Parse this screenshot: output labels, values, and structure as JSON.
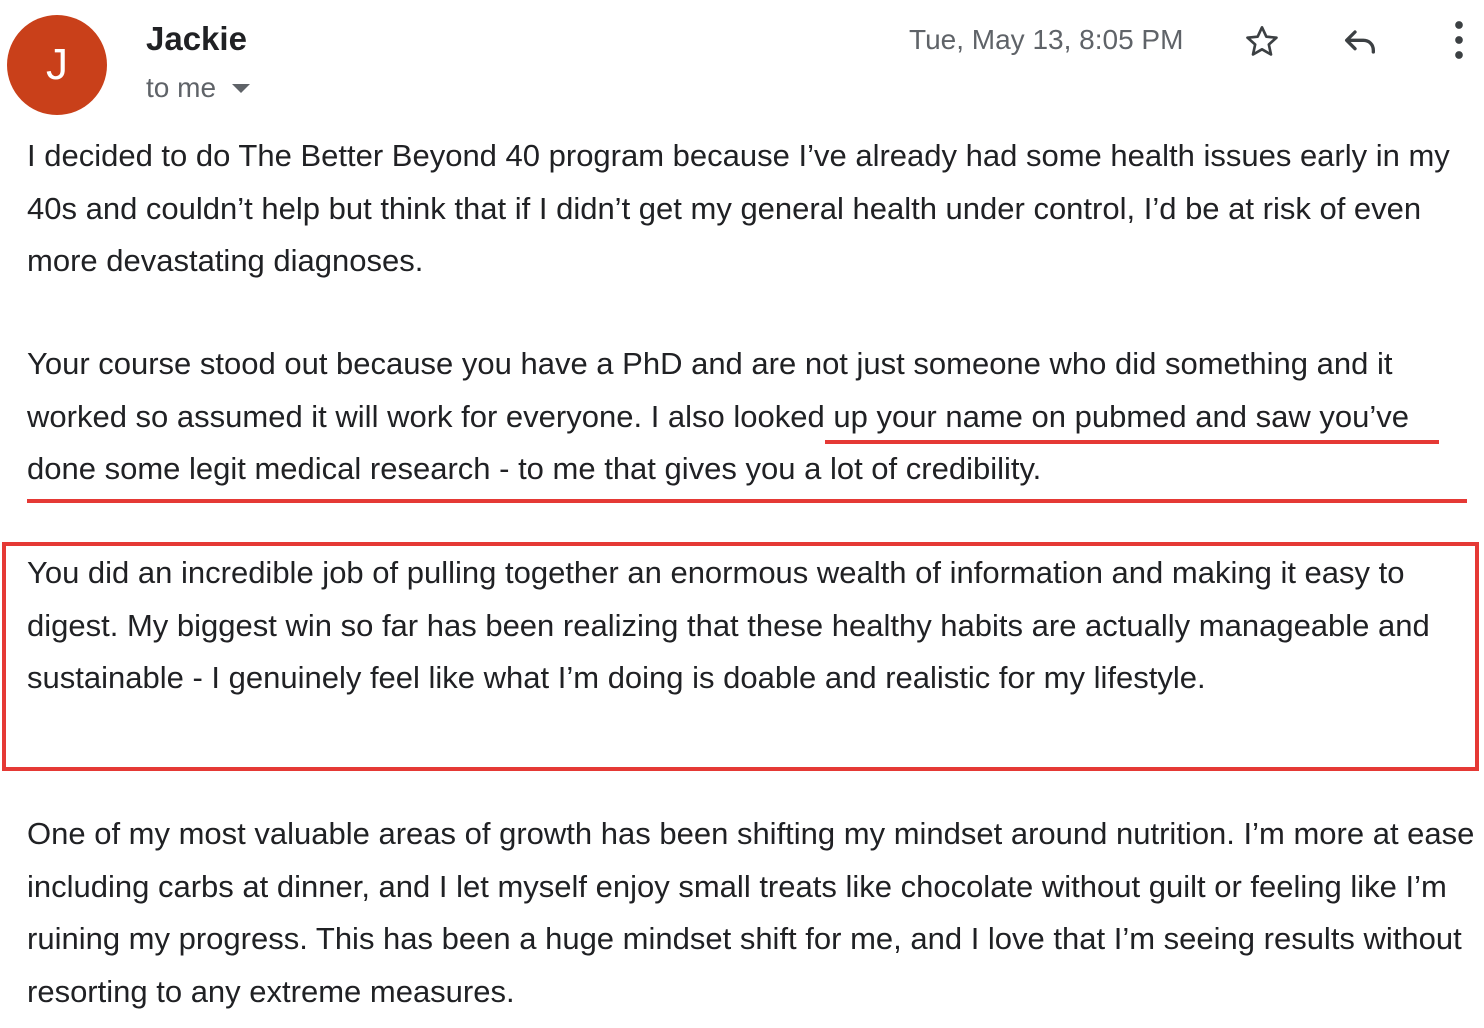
{
  "sender": {
    "initial": "J",
    "name": "Jackie",
    "recipient_label": "to me",
    "avatar_color": "#c9401a"
  },
  "header": {
    "timestamp": "Tue, May 13, 8:05 PM",
    "icons": [
      "star-icon",
      "reply-icon",
      "more-vert-icon"
    ]
  },
  "message": {
    "p1": "I decided to do The Better Beyond 40 program because I’ve already had some health issues early in my 40s and couldn’t help but think that if I didn’t get  my general health under control, I’d be at risk of even more devastating diagnoses.",
    "p2_plain": "Your course stood out because you have a PhD and are not just someone who did something and it worked so assumed it will work for everyone. ",
    "p2_underlined": "I also looked up your name on pubmed and saw you’ve done some legit medical research - to me that gives you a lot of credibility.",
    "p3": "You did an incredible job of pulling together an enormous wealth of information and making it easy to digest. My biggest win so far has been realizing that these healthy habits are actually manageable and sustainable - I genuinely feel like what I’m doing is doable and realistic for my lifestyle.",
    "p4": "One of my most valuable areas of growth has been shifting my mindset around nutrition. I’m more at ease including carbs at dinner, and I let myself enjoy small treats like chocolate without guilt or feeling like I’m ruining my progress. This has been a huge mindset shift for me, and I love that I’m seeing results without resorting to any extreme measures."
  },
  "colors": {
    "annotation_red": "#e53935",
    "text": "#202124",
    "secondary_text": "#5f6368"
  }
}
